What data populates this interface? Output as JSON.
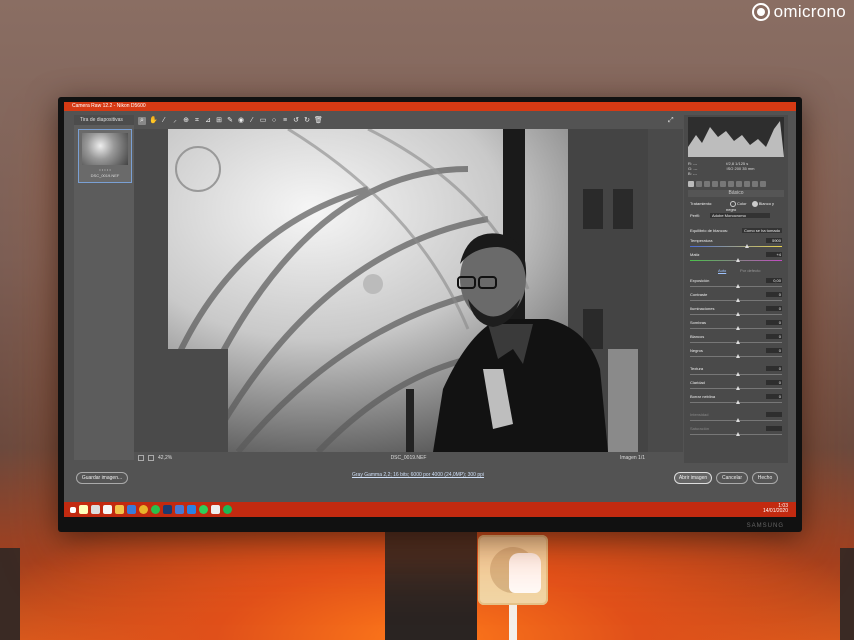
{
  "watermark": {
    "brand": "omicrono",
    "icon": "omicrono-logo-icon"
  },
  "window": {
    "title": "Camera Raw 12.2 - Nikon D5600"
  },
  "filmstrip": {
    "header": "Tira de diapositivas",
    "items": [
      {
        "name": "DSC_0019.NEF",
        "stars": "• • • • •"
      }
    ]
  },
  "toolbar": {
    "icons": [
      "zoom-icon",
      "hand-icon",
      "white-balance-icon",
      "color-sampler-icon",
      "targeted-adjust-icon",
      "crop-icon",
      "straighten-icon",
      "transform-icon",
      "spot-removal-icon",
      "red-eye-icon",
      "adjustment-brush-icon",
      "graduated-filter-icon",
      "radial-filter-icon",
      "preferences-icon",
      "rotate-left-icon",
      "rotate-right-icon",
      "trash-icon"
    ],
    "fullscreen_icon": "fullscreen-icon"
  },
  "preview": {
    "zoom": "42,2%",
    "file_name": "DSC_0019.NEF",
    "image_counter": "Imagen 1/1"
  },
  "panel": {
    "readout": {
      "r": "R:",
      "g": "G:",
      "b": "B:",
      "r_val": "---",
      "g_val": "---",
      "b_val": "---",
      "exposure": "f/2,8 1/125 s",
      "iso": "ISO 200 35 mm"
    },
    "section": "Básico",
    "treatment_label": "Tratamiento:",
    "treatment_color": "Color",
    "treatment_bw": "Blanco y negro",
    "profile_label": "Perfil:",
    "profile_value": "Adobe Monocromo",
    "wb_label": "Equilibrio de blancos:",
    "wb_value": "Como se ha tomado",
    "temp_label": "Temperatura",
    "temp_value": "5900",
    "tint_label": "Matiz",
    "tint_value": "+4",
    "auto": "Auto",
    "default": "Por defecto",
    "sliders": [
      {
        "label": "Exposición",
        "value": "0,00"
      },
      {
        "label": "Contraste",
        "value": "0"
      },
      {
        "label": "Iluminaciones",
        "value": "0"
      },
      {
        "label": "Sombras",
        "value": "0"
      },
      {
        "label": "Blancos",
        "value": "0"
      },
      {
        "label": "Negros",
        "value": "0"
      },
      {
        "label": "Textura",
        "value": "0"
      },
      {
        "label": "Claridad",
        "value": "0"
      },
      {
        "label": "Borrar neblina",
        "value": "0"
      },
      {
        "label": "Intensidad",
        "value": ""
      },
      {
        "label": "Saturación",
        "value": ""
      }
    ]
  },
  "bottom": {
    "save_button": "Guardar imagen...",
    "workflow_link": "Gray Gamma 2,2; 16 bits; 6000 por 4000 (24,0MP); 300 ppi",
    "open_button": "Abrir imagen",
    "cancel_button": "Cancelar",
    "done_button": "Hecho"
  },
  "taskbar": {
    "time": "1:03",
    "date": "14/01/2020",
    "apps": [
      "windows-icon",
      "search-icon",
      "task-view-icon",
      "settings-icon",
      "explorer-icon",
      "mail-icon",
      "chrome-icon",
      "firefox-icon",
      "photoshop-icon",
      "lightroom-icon",
      "edge-icon",
      "whatsapp-icon",
      "store-icon",
      "spotify-icon"
    ]
  },
  "colors": {
    "accent": "#d63a14",
    "taskbar": "#c22a10"
  }
}
